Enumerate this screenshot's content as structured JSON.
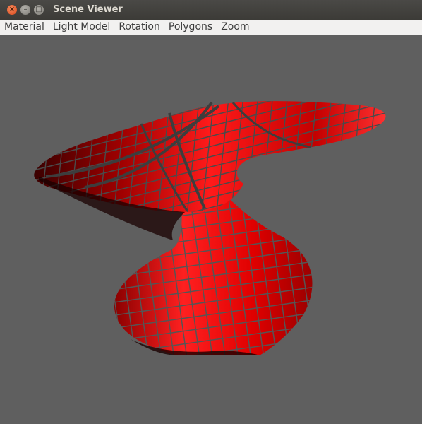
{
  "window": {
    "title": "Scene Viewer",
    "close_glyph": "×",
    "minimize_glyph": "–",
    "maximize_glyph": "□"
  },
  "menubar": {
    "items": [
      {
        "label": "Material"
      },
      {
        "label": "Light Model"
      },
      {
        "label": "Rotation"
      },
      {
        "label": "Polygons"
      },
      {
        "label": "Zoom"
      }
    ]
  },
  "viewport": {
    "background_color": "#5f5f5f",
    "surface_color": "#e00000",
    "grid_color": "#555555"
  }
}
